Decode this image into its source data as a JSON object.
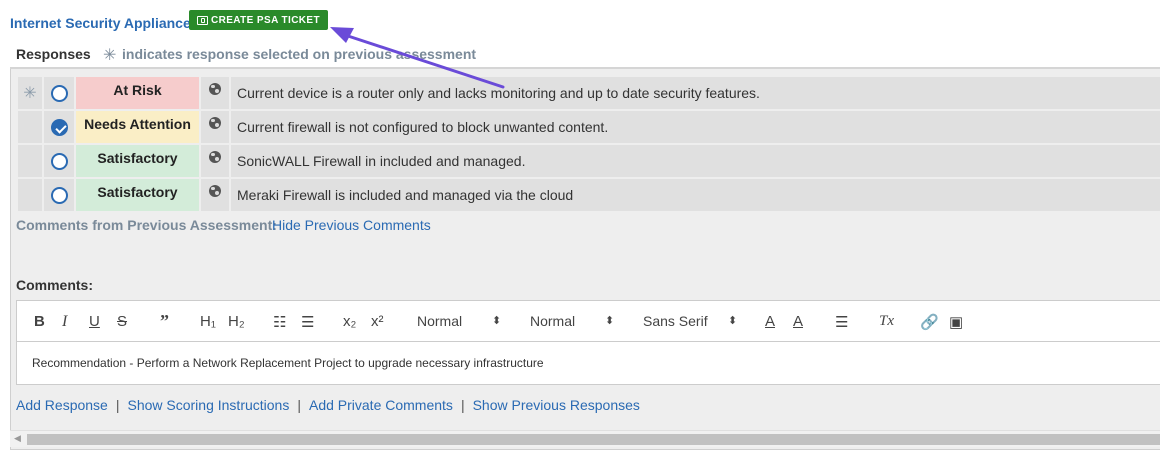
{
  "section": {
    "title": "Internet Security Appliance",
    "psa_button": "CREATE PSA TICKET"
  },
  "responses_header": {
    "label": "Responses",
    "legend_icon": "asterisk-icon",
    "legend_text": "indicates response selected on previous assessment"
  },
  "responses": [
    {
      "previous": true,
      "selected": false,
      "rating": "At Risk",
      "rating_color": "#f6cccc",
      "description": "Current device is a router only and lacks monitoring and up to date security features."
    },
    {
      "previous": false,
      "selected": true,
      "rating": "Needs Attention",
      "rating_color": "#faeec6",
      "description": "Current firewall is not configured to block unwanted content."
    },
    {
      "previous": false,
      "selected": false,
      "rating": "Satisfactory",
      "rating_color": "#d3ecd9",
      "description": "SonicWALL Firewall in included and managed."
    },
    {
      "previous": false,
      "selected": false,
      "rating": "Satisfactory",
      "rating_color": "#d3ecd9",
      "description": "Meraki Firewall is included and managed via the cloud"
    }
  ],
  "previous_comments": {
    "label": "Comments from Previous Assessment:",
    "hide_link": "Hide Previous Comments"
  },
  "comments": {
    "label": "Comments:",
    "toolbar": {
      "bold": "B",
      "italic": "I",
      "underline": "U",
      "strike": "S",
      "blockquote": "”",
      "h1": "H₁",
      "h2": "H₂",
      "ordered_list": "☷",
      "bullet_list": "☰",
      "subscript": "x₂",
      "superscript": "x²",
      "header_select": "Normal",
      "size_select": "Normal",
      "font_select": "Sans Serif",
      "text_color": "A",
      "background_color": "A",
      "align": "☰",
      "clear_format": "Tx",
      "link": "🔗",
      "image": "▣"
    },
    "text": "Recommendation - Perform a Network Replacement Project to upgrade necessary infrastructure"
  },
  "footer_links": [
    "Add Response",
    "Show Scoring Instructions",
    "Add Private Comments",
    "Show Previous Responses"
  ],
  "colors": {
    "link_blue": "#2a6ab3",
    "button_green": "#2a8a2a",
    "annotation_arrow": "#6a4bd8"
  }
}
